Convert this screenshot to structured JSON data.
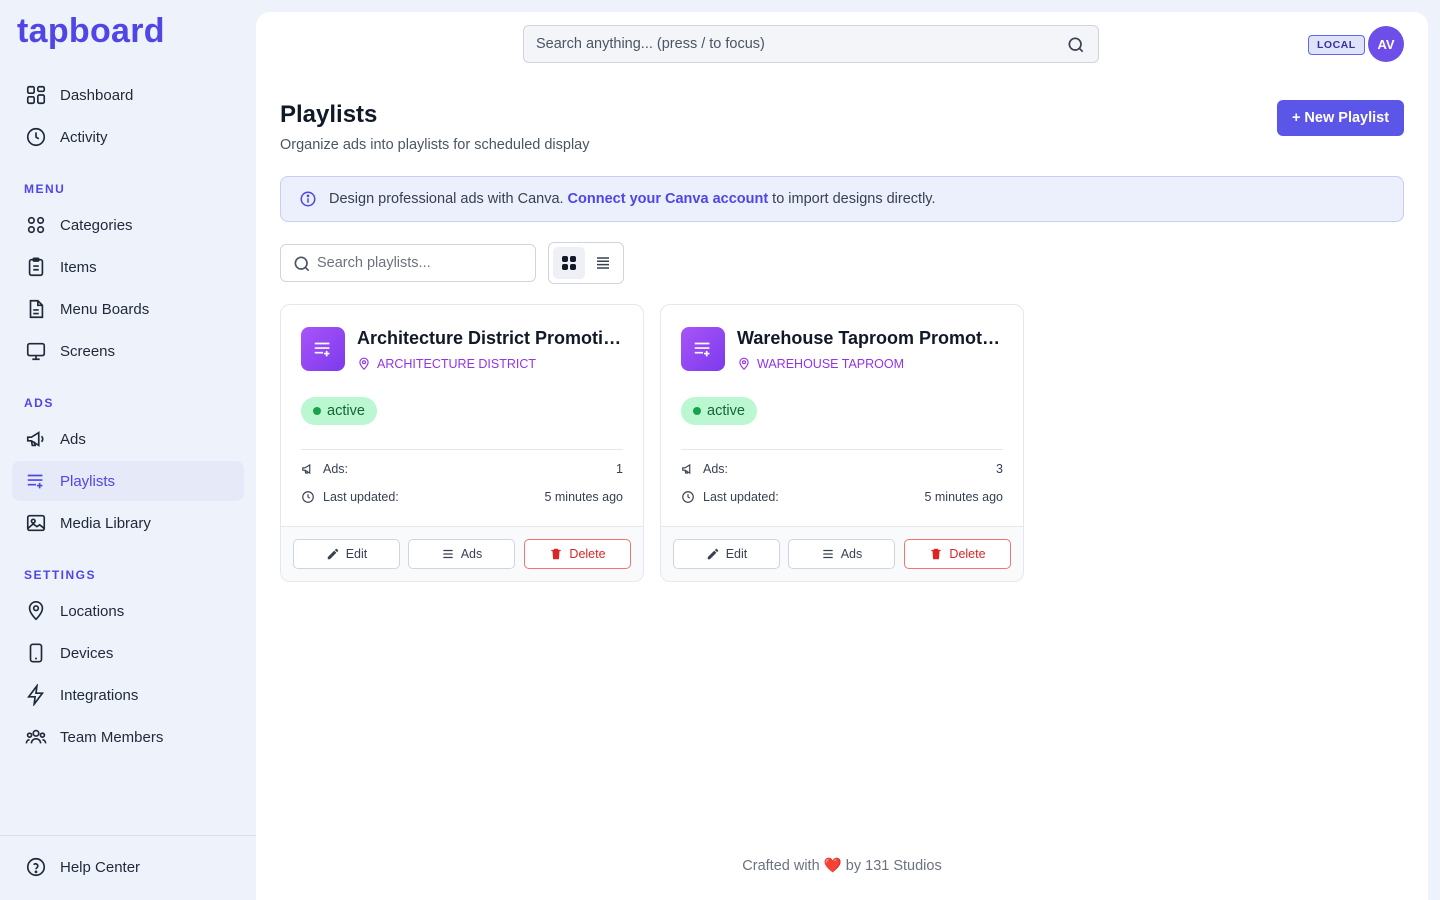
{
  "app": {
    "logo": "tapboard"
  },
  "sidebar": {
    "top_items": [
      {
        "label": "Dashboard",
        "icon": "grid-icon"
      },
      {
        "label": "Activity",
        "icon": "clock-icon"
      }
    ],
    "sections": [
      {
        "label": "MENU",
        "items": [
          {
            "label": "Categories",
            "icon": "grid-icon"
          },
          {
            "label": "Items",
            "icon": "clipboard-icon"
          },
          {
            "label": "Menu Boards",
            "icon": "document-icon"
          },
          {
            "label": "Screens",
            "icon": "monitor-icon"
          }
        ]
      },
      {
        "label": "ADS",
        "items": [
          {
            "label": "Ads",
            "icon": "megaphone-icon"
          },
          {
            "label": "Playlists",
            "icon": "playlist-icon",
            "active": true
          },
          {
            "label": "Media Library",
            "icon": "image-icon"
          }
        ]
      },
      {
        "label": "SETTINGS",
        "items": [
          {
            "label": "Locations",
            "icon": "map-pin-icon"
          },
          {
            "label": "Devices",
            "icon": "phone-icon"
          },
          {
            "label": "Integrations",
            "icon": "bolt-icon"
          },
          {
            "label": "Team Members",
            "icon": "users-icon"
          }
        ]
      }
    ],
    "bottom_item": {
      "label": "Help Center",
      "icon": "help-icon"
    }
  },
  "header": {
    "search_placeholder": "Search anything... (press / to focus)",
    "env_badge": "LOCAL",
    "avatar_initials": "AV"
  },
  "page": {
    "title": "Playlists",
    "subtitle": "Organize ads into playlists for scheduled display",
    "new_button": "+ New Playlist",
    "banner": {
      "prefix": "Design professional ads with Canva.",
      "link": "Connect your Canva account",
      "suffix": "to import designs directly."
    },
    "search_placeholder": "Search playlists..."
  },
  "playlists": [
    {
      "title": "Architecture District Promotions",
      "location": "ARCHITECTURE DISTRICT",
      "status": "active",
      "ads_label": "Ads:",
      "ads_count": "1",
      "updated_label": "Last updated:",
      "updated_value": "5 minutes ago",
      "edit_label": "Edit",
      "ads_btn_label": "Ads",
      "delete_label": "Delete"
    },
    {
      "title": "Warehouse Taproom Promotions",
      "location": "WAREHOUSE TAPROOM",
      "status": "active",
      "ads_label": "Ads:",
      "ads_count": "3",
      "updated_label": "Last updated:",
      "updated_value": "5 minutes ago",
      "edit_label": "Edit",
      "ads_btn_label": "Ads",
      "delete_label": "Delete"
    }
  ],
  "footer": {
    "prefix": "Crafted with",
    "heart": "❤️",
    "suffix": "by 131 Studios"
  },
  "colors": {
    "accent": "#4f46e5",
    "primary_button": "#5b55e8",
    "status_active_bg": "#bbf7d0",
    "location_text": "#9333ea"
  }
}
